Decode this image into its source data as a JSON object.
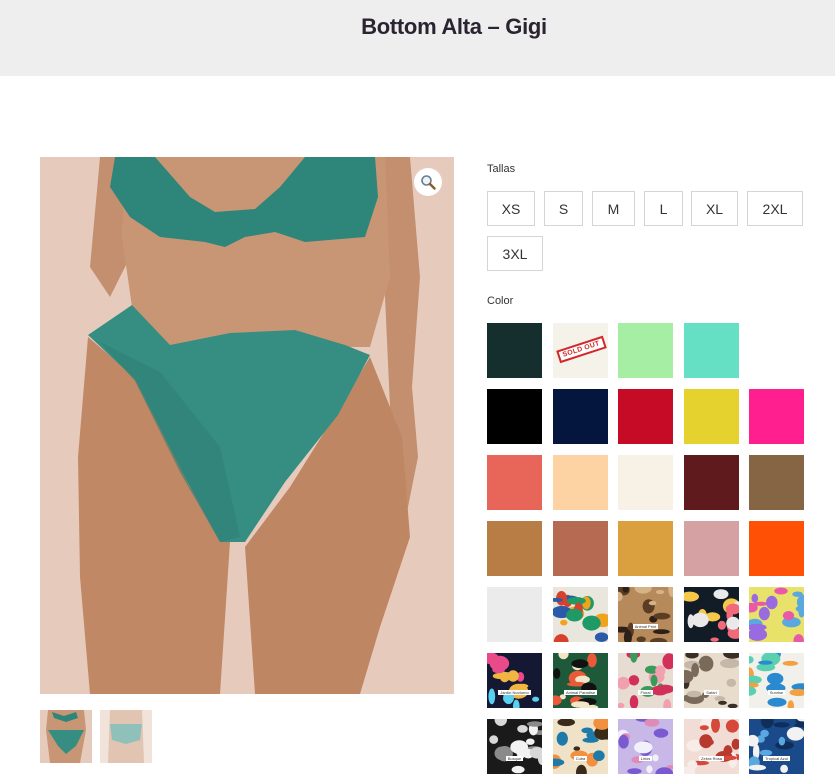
{
  "header": {
    "title": "Bottom Alta – Gigi"
  },
  "product": {
    "main_image_alt": "Bikini verde",
    "thumbnails": [
      "thumbnail-1",
      "thumbnail-2"
    ]
  },
  "sizes": {
    "label": "Tallas",
    "options": [
      "XS",
      "S",
      "M",
      "L",
      "XL",
      "2XL",
      "3XL"
    ]
  },
  "colors": {
    "label": "Color",
    "sold_out_text": "SOLD OUT",
    "swatches": [
      {
        "color": "#152f2e"
      },
      {
        "color": "#f5f2ea",
        "sold_out": true
      },
      {
        "color": "#a7eea5"
      },
      {
        "color": "#66e0c5"
      },
      {
        "color": "#ffffff"
      },
      {
        "color": "#000000"
      },
      {
        "color": "#04163d"
      },
      {
        "color": "#c50b26"
      },
      {
        "color": "#e6d22e"
      },
      {
        "color": "#ff1f8e"
      },
      {
        "color": "#e86659"
      },
      {
        "color": "#fed3a4"
      },
      {
        "color": "#f8f1e6"
      },
      {
        "color": "#5e1a1c"
      },
      {
        "color": "#866545"
      },
      {
        "color": "#b87c45"
      },
      {
        "color": "#b76a52"
      },
      {
        "color": "#daa040"
      },
      {
        "color": "#d5a1a2"
      },
      {
        "color": "#ff5005"
      },
      {
        "color": "#ebebeb"
      },
      {
        "pattern": [
          "#e9e6de",
          "#d6402c",
          "#f2a31e",
          "#2a5aa8",
          "#1f9a67"
        ]
      },
      {
        "pattern": [
          "#b68a5a",
          "#5a3d22",
          "#d6b386",
          "#2d2018"
        ],
        "label": "Animal Print"
      },
      {
        "pattern": [
          "#111c26",
          "#f26a7a",
          "#f6c84a",
          "#e9e9e9"
        ]
      },
      {
        "pattern": [
          "#e8e26a",
          "#5aa8e0",
          "#e85aa8",
          "#9a6ae0"
        ]
      },
      {
        "pattern": [
          "#141833",
          "#e84a8a",
          "#f2b640",
          "#5ad0f0"
        ],
        "label": "Jardín Nocturno"
      },
      {
        "pattern": [
          "#1e5a3a",
          "#f2e6c6",
          "#e85a3a",
          "#111111"
        ],
        "label": "Animal Paradise"
      },
      {
        "pattern": [
          "#e6dcd2",
          "#d2305a",
          "#3a9a5a",
          "#f2a0b0"
        ],
        "label": "Floral"
      },
      {
        "pattern": [
          "#e8dccc",
          "#7a6a5a",
          "#c6b8a8",
          "#3a2f26"
        ],
        "label": "Safari"
      },
      {
        "pattern": [
          "#f2f0ea",
          "#2a8ad0",
          "#f2a040",
          "#5ad0b0"
        ],
        "label": "Sunrise"
      },
      {
        "pattern": [
          "#1a1a1a",
          "#f2f2f2",
          "#8a8a8a",
          "#d8d8d8"
        ],
        "label": "Bosque"
      },
      {
        "pattern": [
          "#f0e2c6",
          "#1e7aa8",
          "#f29040",
          "#3a2a1a"
        ],
        "label": "Cuba"
      },
      {
        "pattern": [
          "#c8b8e8",
          "#7a5ad0",
          "#f2f0fa",
          "#e08ab8"
        ],
        "label": "Lirios"
      },
      {
        "pattern": [
          "#f2ddd6",
          "#d6483a",
          "#f7ece8",
          "#b83a2e"
        ],
        "label": "Zebra Rosa"
      },
      {
        "pattern": [
          "#1a4a8a",
          "#f2f2f2",
          "#5aa8e0",
          "#0f2f5a"
        ],
        "label": "Tropical Azul"
      }
    ]
  }
}
